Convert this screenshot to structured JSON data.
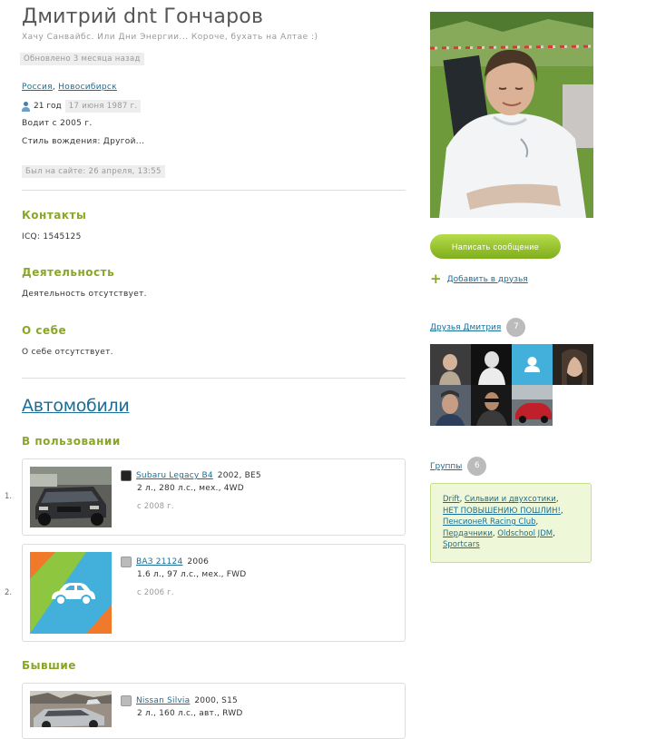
{
  "profile": {
    "name": "Дмитрий dnt Гончаров",
    "status": "Хачу Санвайбс. Или Дни Энергии... Короче, бухать на Алтае :)",
    "updated": "Обновлено 3 месяца назад",
    "country": "Россия",
    "city": "Новосибирск",
    "age": "21 год",
    "birthday": "17 июня 1987 г.",
    "driving_since": "Водит с 2005 г.",
    "driving_style": "Стиль вождения: Другой...",
    "last_seen": "Был на сайте: 26 апреля, 13:55"
  },
  "contacts": {
    "title": "Контакты",
    "icq": "ICQ: 1545125"
  },
  "activity": {
    "title": "Деятельность",
    "text": "Деятельность отсутствует."
  },
  "about": {
    "title": "О себе",
    "text": "О себе отсутствует."
  },
  "cars": {
    "title": "Автомобили",
    "in_use_title": "В пользовании",
    "former_title": "Бывшие",
    "in_use": [
      {
        "num": "1.",
        "name": "Subaru Legacy B4",
        "year_body": "2002, BE5",
        "specs": "2 л., 280 л.с., мех., 4WD",
        "since": "с 2008 г."
      },
      {
        "num": "2.",
        "name": "ВАЗ 21124",
        "year_body": "2006",
        "specs": "1.6 л., 97 л.с., мех., FWD",
        "since": "с 2006 г."
      }
    ],
    "former": [
      {
        "name": "Nissan Silvia",
        "year_body": "2000, S15",
        "specs": "2 л., 160 л.с., авт., RWD"
      }
    ]
  },
  "sidebar": {
    "message_button": "Написать сообщение",
    "add_friend": "Добавить в друзья",
    "friends_label": "Друзья Дмитрия",
    "friends_count": "7",
    "groups_label": "Группы",
    "groups_count": "6",
    "groups": [
      "Drift",
      "Сильвии и двухсотики",
      "НЕТ ПОВЫШЕНИЮ ПОШЛИН!",
      "ПенсионеR Racing Club",
      "Пердачники",
      "Oldschool JDM",
      "Sportcars"
    ]
  },
  "colors": {
    "accent_green": "#8aa628",
    "link_blue": "#1a6d96",
    "button_green": "#8cbf26"
  }
}
